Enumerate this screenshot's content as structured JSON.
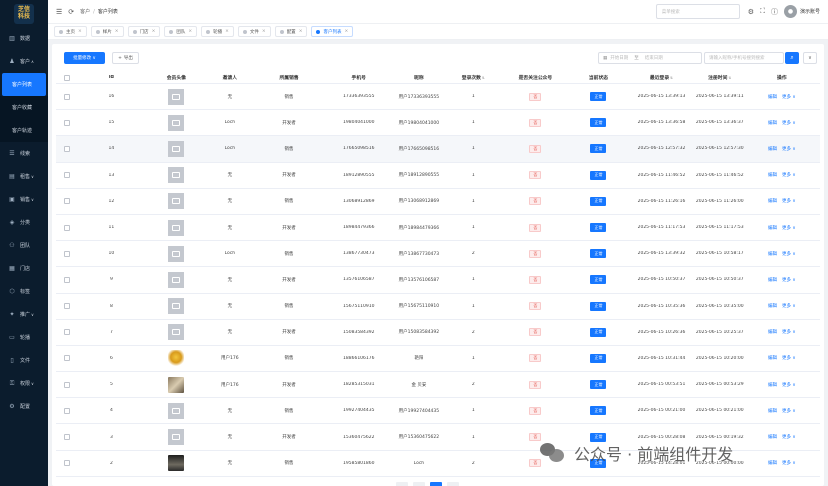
{
  "logo": {
    "line1": "芝信",
    "line2": "科技"
  },
  "sidebar": {
    "items": [
      {
        "icon": "chart-icon",
        "label": "数据"
      },
      {
        "icon": "user-icon",
        "label": "客户",
        "expanded": true,
        "children": [
          {
            "label": "客户列表",
            "active": true
          },
          {
            "label": "客户收藏"
          },
          {
            "label": "客户轨迹"
          }
        ]
      },
      {
        "icon": "list-icon",
        "label": "线索"
      },
      {
        "icon": "lease-icon",
        "label": "租售",
        "chevron": true
      },
      {
        "icon": "cart-icon",
        "label": "销售",
        "chevron": true
      },
      {
        "icon": "category-icon",
        "label": "分类"
      },
      {
        "icon": "team-icon",
        "label": "团队"
      },
      {
        "icon": "store-icon",
        "label": "门店"
      },
      {
        "icon": "tag-icon",
        "label": "标签"
      },
      {
        "icon": "promo-icon",
        "label": "推广",
        "chevron": true
      },
      {
        "icon": "banner-icon",
        "label": "轮播"
      },
      {
        "icon": "file-icon",
        "label": "文件"
      },
      {
        "icon": "lock-icon",
        "label": "权限",
        "chevron": true
      },
      {
        "icon": "gear-icon",
        "label": "配置"
      }
    ]
  },
  "topbar": {
    "breadcrumb": [
      "客户",
      "客户列表"
    ],
    "menu_search_placeholder": "菜单搜索",
    "username": "演示账号"
  },
  "tabs": [
    {
      "label": "主页"
    },
    {
      "label": "样片"
    },
    {
      "label": "门店"
    },
    {
      "label": "团队"
    },
    {
      "label": "轮播"
    },
    {
      "label": "文件"
    },
    {
      "label": "配置"
    },
    {
      "label": "客户列表",
      "active": true
    }
  ],
  "toolbar": {
    "batch": "批量修改 ∨",
    "export": "导出",
    "date_start": "开始日期",
    "date_sep": "至",
    "date_end": "结束日期",
    "keyword_placeholder": "请输入昵称/手机号搜到搜索"
  },
  "table": {
    "headers": [
      "id",
      "会员头像",
      "邀请人",
      "所属销售",
      "手机号",
      "昵称",
      "登录次数",
      "是否关注公众号",
      "当前状态",
      "最近登录",
      "注册时间",
      "操作"
    ],
    "rows": [
      {
        "id": "16",
        "inviter": "无",
        "sales": "销售",
        "phone": "17336393555",
        "nick": "用户17336393555",
        "logins": "1",
        "follow": "否",
        "status": "正常",
        "last": "2025-06-15 13:39:13",
        "reg": "2025-06-15 13:39:11"
      },
      {
        "id": "15",
        "inviter": "Loch",
        "sales": "开发者",
        "phone": "19804041000",
        "nick": "用户19804041000",
        "logins": "1",
        "follow": "否",
        "status": "正常",
        "last": "2025-06-15 13:36:58",
        "reg": "2025-06-15 13:36:37"
      },
      {
        "id": "14",
        "inviter": "Loch",
        "sales": "销售",
        "phone": "17665098516",
        "nick": "用户17665098516",
        "logins": "1",
        "follow": "否",
        "status": "正常",
        "last": "2025-06-15 12:57:32",
        "reg": "2025-06-15 12:57:30",
        "hl": true
      },
      {
        "id": "13",
        "inviter": "无",
        "sales": "开发者",
        "phone": "18912890555",
        "nick": "用户18912890555",
        "logins": "1",
        "follow": "否",
        "status": "正常",
        "last": "2025-06-15 11:46:52",
        "reg": "2025-06-15 11:46:52"
      },
      {
        "id": "12",
        "inviter": "无",
        "sales": "销售",
        "phone": "13068912869",
        "nick": "用户13068912869",
        "logins": "1",
        "follow": "否",
        "status": "正常",
        "last": "2025-06-15 11:26:16",
        "reg": "2025-06-15 11:26:00"
      },
      {
        "id": "11",
        "inviter": "无",
        "sales": "开发者",
        "phone": "18984479366",
        "nick": "用户18984479366",
        "logins": "1",
        "follow": "否",
        "status": "正常",
        "last": "2025-06-15 11:17:53",
        "reg": "2025-06-15 11:17:53"
      },
      {
        "id": "10",
        "inviter": "Loch",
        "sales": "销售",
        "phone": "13867730473",
        "nick": "用户13867730473",
        "logins": "2",
        "follow": "否",
        "status": "正常",
        "last": "2025-06-15 13:39:32",
        "reg": "2025-06-15 10:58:17"
      },
      {
        "id": "9",
        "inviter": "无",
        "sales": "开发者",
        "phone": "13576106587",
        "nick": "用户13576106587",
        "logins": "1",
        "follow": "否",
        "status": "正常",
        "last": "2025-06-15 10:50:37",
        "reg": "2025-06-15 10:50:37"
      },
      {
        "id": "8",
        "inviter": "无",
        "sales": "销售",
        "phone": "15675110910",
        "nick": "用户15675110910",
        "logins": "1",
        "follow": "否",
        "status": "正常",
        "last": "2025-06-15 10:35:36",
        "reg": "2025-06-15 10:35:00"
      },
      {
        "id": "7",
        "inviter": "无",
        "sales": "开发者",
        "phone": "15083584392",
        "nick": "用户15083584392",
        "logins": "2",
        "follow": "否",
        "status": "正常",
        "last": "2025-06-15 10:26:36",
        "reg": "2025-06-15 10:25:37"
      },
      {
        "id": "6",
        "inviter": "用户176",
        "sales": "销售",
        "phone": "18866106176",
        "nick": "艳阳",
        "logins": "1",
        "follow": "否",
        "status": "正常",
        "last": "2025-06-15 10:31:44",
        "reg": "2025-06-15 10:20:00",
        "avatar": "gold"
      },
      {
        "id": "5",
        "inviter": "用户176",
        "sales": "开发者",
        "phone": "18285315031",
        "nick": "金 贝安",
        "logins": "2",
        "follow": "否",
        "status": "正常",
        "last": "2025-06-15 00:53:51",
        "reg": "2025-06-15 00:53:29",
        "avatar": "cat"
      },
      {
        "id": "4",
        "inviter": "无",
        "sales": "销售",
        "phone": "19927404435",
        "nick": "用户19927404435",
        "logins": "1",
        "follow": "否",
        "status": "正常",
        "last": "2025-06-15 00:21:00",
        "reg": "2025-06-15 00:21:00"
      },
      {
        "id": "3",
        "inviter": "无",
        "sales": "开发者",
        "phone": "15360475622",
        "nick": "用户15360475622",
        "logins": "1",
        "follow": "否",
        "status": "正常",
        "last": "2025-06-15 00:28:08",
        "reg": "2025-06-15 00:19:32"
      },
      {
        "id": "2",
        "inviter": "无",
        "sales": "销售",
        "phone": "19585801860",
        "nick": "Loch",
        "logins": "2",
        "follow": "否",
        "status": "正常",
        "last": "2025-06-15 14:28:01",
        "reg": "2025-06-15 00:00:00",
        "avatar": "dark"
      }
    ],
    "op_edit": "编辑",
    "op_more": "更多 ∨"
  },
  "watermark": {
    "text": "公众号 · 前端组件开发"
  }
}
